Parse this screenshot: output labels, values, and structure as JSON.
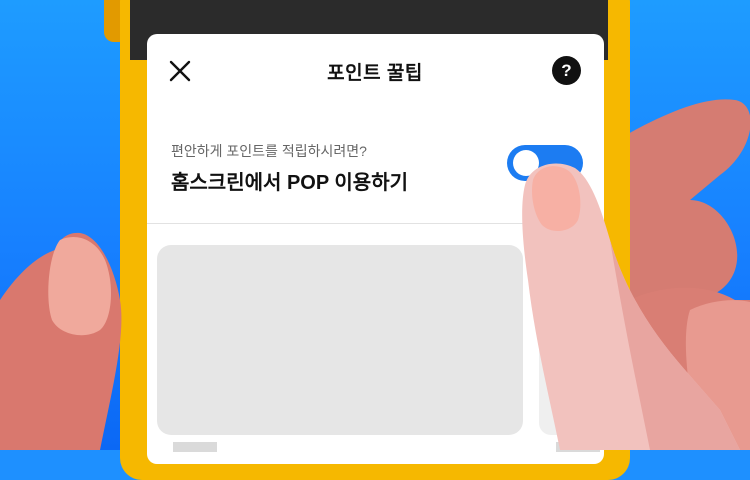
{
  "header": {
    "title": "포인트 꿀팁",
    "close_icon": "close-icon",
    "help_label": "?"
  },
  "setting": {
    "subtext": "편안하게 포인트를 적립하시려면?",
    "label": "홈스크린에서 POP 이용하기",
    "toggle_on": true
  },
  "colors": {
    "background": "#1E90FF",
    "phone_frame": "#F6B800",
    "toggle_accent": "#1C7CF2",
    "hand_skin": "#E88A80"
  }
}
